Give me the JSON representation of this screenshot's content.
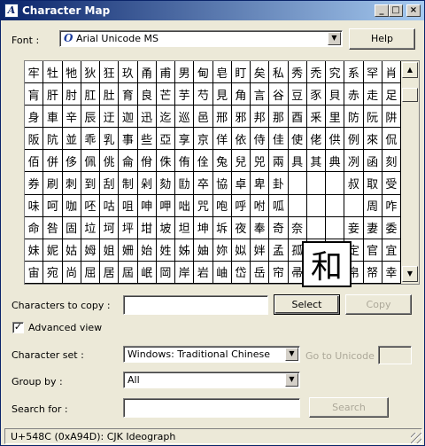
{
  "window": {
    "title": "Character Map",
    "app_icon": "charmap-app-icon",
    "min_label": "_",
    "max_label": "□",
    "close_label": "×"
  },
  "font": {
    "label": "Font :",
    "value": "Arial Unicode MS",
    "icon": "opentype-icon",
    "help_label": "Help"
  },
  "grid": {
    "characters": [
      "牢",
      "牡",
      "牠",
      "狄",
      "狂",
      "玖",
      "甬",
      "甫",
      "男",
      "甸",
      "皂",
      "盯",
      "矣",
      "私",
      "秀",
      "禿",
      "究",
      "系",
      "罕",
      "肖",
      "肓",
      "肝",
      "肘",
      "肛",
      "肚",
      "育",
      "良",
      "芒",
      "芋",
      "芍",
      "見",
      "角",
      "言",
      "谷",
      "豆",
      "豕",
      "貝",
      "赤",
      "走",
      "足",
      "身",
      "車",
      "辛",
      "辰",
      "迂",
      "迦",
      "迅",
      "迄",
      "巡",
      "邑",
      "邢",
      "邪",
      "邦",
      "那",
      "酉",
      "釆",
      "里",
      "防",
      "阮",
      "阱",
      "阪",
      "阬",
      "並",
      "乖",
      "乳",
      "事",
      "些",
      "亞",
      "享",
      "京",
      "佯",
      "依",
      "侍",
      "佳",
      "使",
      "佬",
      "供",
      "例",
      "來",
      "侃",
      "佰",
      "併",
      "侈",
      "佩",
      "佻",
      "侖",
      "佾",
      "侏",
      "侑",
      "佺",
      "兔",
      "兒",
      "兕",
      "兩",
      "具",
      "其",
      "典",
      "冽",
      "函",
      "刻",
      "券",
      "刷",
      "刺",
      "到",
      "刮",
      "制",
      "剁",
      "劾",
      "劻",
      "卒",
      "協",
      "卓",
      "卑",
      "卦",
      "",
      "",
      "",
      "叔",
      "取",
      "受",
      "味",
      "呵",
      "咖",
      "呸",
      "咕",
      "咀",
      "呻",
      "呷",
      "咄",
      "咒",
      "咆",
      "呼",
      "咐",
      "呱",
      "",
      "",
      "",
      "",
      "周",
      "咋",
      "命",
      "咎",
      "固",
      "垃",
      "坷",
      "坪",
      "坩",
      "坡",
      "坦",
      "坤",
      "坼",
      "夜",
      "奉",
      "奇",
      "奈",
      "",
      "",
      "妾",
      "妻",
      "委",
      "妹",
      "妮",
      "姑",
      "姆",
      "姐",
      "姍",
      "始",
      "姓",
      "姊",
      "妯",
      "妳",
      "姒",
      "姅",
      "孟",
      "孤",
      "季",
      "宗",
      "定",
      "官",
      "宜",
      "宙",
      "宛",
      "尚",
      "屈",
      "居",
      "屆",
      "岷",
      "岡",
      "岸",
      "岩",
      "岫",
      "岱",
      "岳",
      "帘",
      "帚",
      "帖",
      "帕",
      "帛",
      "帑",
      "幸"
    ],
    "zoom_char": "和"
  },
  "copy": {
    "label": "Characters to copy :",
    "value": "",
    "select_label": "Select",
    "copy_label": "Copy"
  },
  "advanced": {
    "label": "Advanced view",
    "checked": true,
    "check_mark": "✓"
  },
  "charset": {
    "label": "Character set :",
    "value": "Windows: Traditional Chinese",
    "goto_label": "Go to Unicode :",
    "goto_value": ""
  },
  "groupby": {
    "label": "Group by :",
    "value": "All"
  },
  "search": {
    "label": "Search for :",
    "value": "",
    "button_label": "Search"
  },
  "status": {
    "text": "U+548C (0xA94D): CJK Ideograph"
  }
}
